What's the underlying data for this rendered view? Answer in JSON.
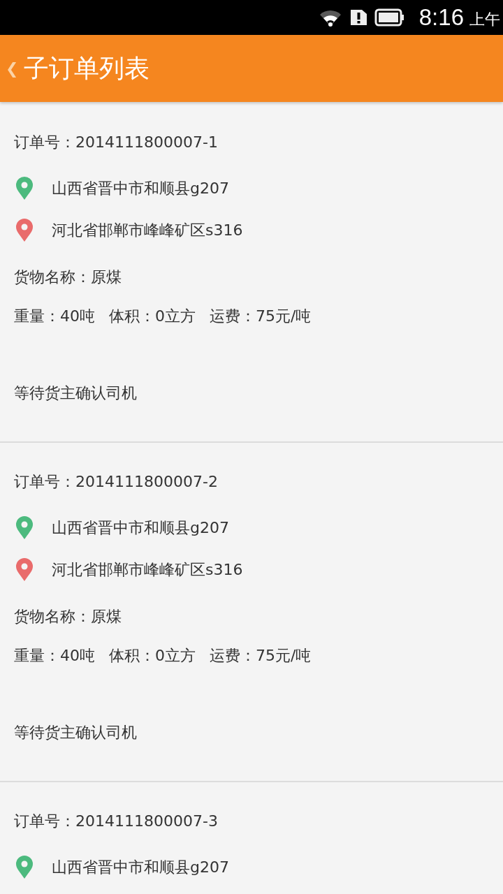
{
  "status_bar": {
    "time": "8:16",
    "period": "上午"
  },
  "header": {
    "back": "❮",
    "title": "子订单列表"
  },
  "orders": [
    {
      "order_no": "订单号：2014111800007-1",
      "origin": "山西省晋中市和顺县g207",
      "destination": "河北省邯郸市峰峰矿区s316",
      "goods": "货物名称：原煤",
      "weight": "重量：40吨",
      "volume": "体积：0立方",
      "freight": "运费：75元/吨",
      "status": "等待货主确认司机"
    },
    {
      "order_no": "订单号：2014111800007-2",
      "origin": "山西省晋中市和顺县g207",
      "destination": "河北省邯郸市峰峰矿区s316",
      "goods": "货物名称：原煤",
      "weight": "重量：40吨",
      "volume": "体积：0立方",
      "freight": "运费：75元/吨",
      "status": "等待货主确认司机"
    },
    {
      "order_no": "订单号：2014111800007-3",
      "origin": "山西省晋中市和顺县g207"
    }
  ]
}
